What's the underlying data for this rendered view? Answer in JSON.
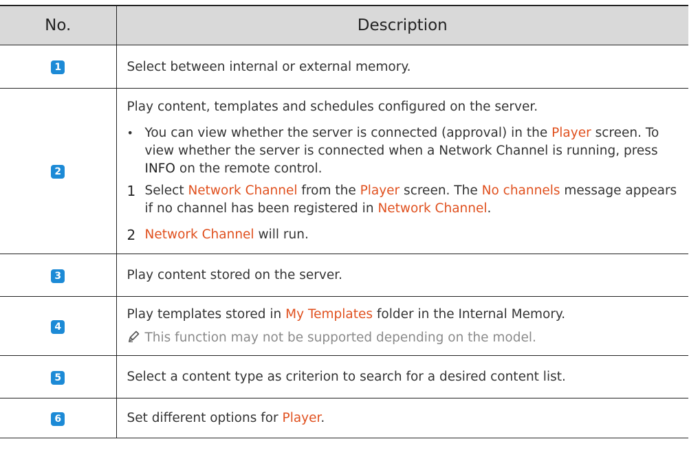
{
  "header": {
    "no": "No.",
    "description": "Description"
  },
  "rows": [
    {
      "num": "1",
      "text": "Select between internal or external memory."
    },
    {
      "num": "2",
      "intro": "Play content, templates and schedules configured on the server.",
      "bullet": {
        "mark": "•",
        "p1": "You can view whether the server is connected (approval) in the ",
        "link": "Player",
        "p2": " screen. To view whether the server is connected when a Network Channel is running, press ",
        "bold": "INFO",
        "p3": " on the remote control."
      },
      "steps": [
        {
          "num": "1",
          "a": "Select ",
          "b": "Network Channel",
          "c": " from the ",
          "d": "Player",
          "e": " screen. The ",
          "f": "No channels",
          "g": " message appears if no channel has been registered in ",
          "h": "Network Channel",
          "i": "."
        },
        {
          "num": "2",
          "a": "Network Channel",
          "b": " will run."
        }
      ]
    },
    {
      "num": "3",
      "text": "Play content stored on the server."
    },
    {
      "num": "4",
      "a": "Play templates stored in ",
      "b": "My Templates",
      "c": " folder in the Internal Memory.",
      "note_icon": "pencil-note-icon",
      "note": "This function may not be supported depending on the model."
    },
    {
      "num": "5",
      "text": "Select a content type as criterion to search for a desired content list."
    },
    {
      "num": "6",
      "a": "Set different options for ",
      "b": "Player",
      "c": "."
    }
  ],
  "colors": {
    "badge": "#1c8ad6",
    "highlight": "#e0501e",
    "header_bg": "#d9d9d9"
  }
}
